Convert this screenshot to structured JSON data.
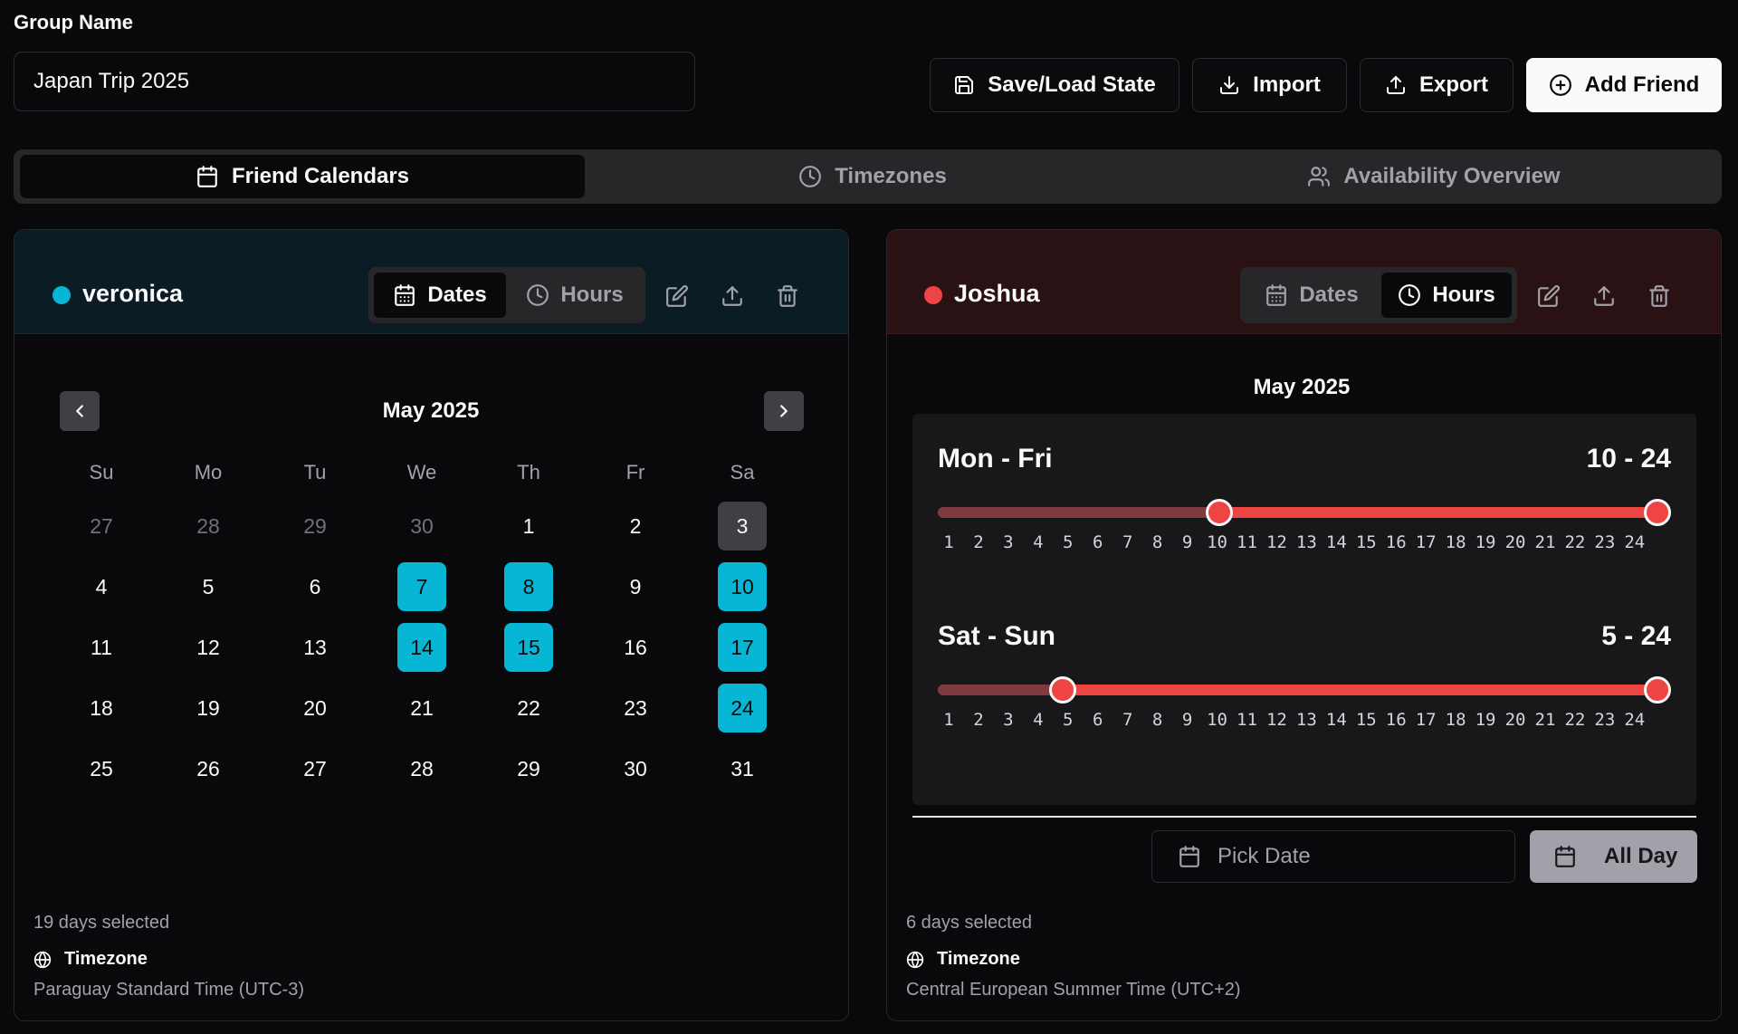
{
  "header": {
    "group_label": "Group Name",
    "group_value": "Japan Trip 2025",
    "buttons": {
      "save_load": "Save/Load State",
      "import": "Import",
      "export": "Export",
      "add_friend": "Add Friend"
    }
  },
  "tabs": {
    "friend_calendars": "Friend Calendars",
    "timezones": "Timezones",
    "availability_overview": "Availability Overview",
    "active": "friend_calendars"
  },
  "friends": [
    {
      "name": "veronica",
      "color": "#06b6d4",
      "mode_dates": "Dates",
      "mode_hours": "Hours",
      "active_mode": "Dates",
      "calendar": {
        "month_label": "May 2025",
        "weekdays": [
          "Su",
          "Mo",
          "Tu",
          "We",
          "Th",
          "Fr",
          "Sa"
        ],
        "weeks": [
          [
            {
              "d": "27",
              "out": true
            },
            {
              "d": "28",
              "out": true
            },
            {
              "d": "29",
              "out": true
            },
            {
              "d": "30",
              "out": true
            },
            {
              "d": "1"
            },
            {
              "d": "2"
            },
            {
              "d": "3",
              "today": true
            }
          ],
          [
            {
              "d": "4"
            },
            {
              "d": "5"
            },
            {
              "d": "6"
            },
            {
              "d": "7",
              "sel": true
            },
            {
              "d": "8",
              "sel": true
            },
            {
              "d": "9"
            },
            {
              "d": "10",
              "sel": true
            }
          ],
          [
            {
              "d": "11"
            },
            {
              "d": "12"
            },
            {
              "d": "13"
            },
            {
              "d": "14",
              "sel": true
            },
            {
              "d": "15",
              "sel": true
            },
            {
              "d": "16"
            },
            {
              "d": "17",
              "sel": true
            }
          ],
          [
            {
              "d": "18"
            },
            {
              "d": "19"
            },
            {
              "d": "20"
            },
            {
              "d": "21"
            },
            {
              "d": "22"
            },
            {
              "d": "23"
            },
            {
              "d": "24",
              "sel": true
            }
          ],
          [
            {
              "d": "25"
            },
            {
              "d": "26"
            },
            {
              "d": "27"
            },
            {
              "d": "28"
            },
            {
              "d": "29"
            },
            {
              "d": "30"
            },
            {
              "d": "31"
            }
          ]
        ]
      },
      "selected_count": "19 days selected",
      "timezone_label": "Timezone",
      "timezone": "Paraguay Standard Time (UTC-3)"
    },
    {
      "name": "Joshua",
      "color": "#ef4444",
      "mode_dates": "Dates",
      "mode_hours": "Hours",
      "active_mode": "Hours",
      "hours": {
        "month_label": "May 2025",
        "ranges": [
          {
            "label": "Mon - Fri",
            "value": "10 - 24",
            "start": 10,
            "end": 24
          },
          {
            "label": "Sat - Sun",
            "value": "5 - 24",
            "start": 5,
            "end": 24
          }
        ],
        "scale_min": 1,
        "scale_max": 24,
        "ticks": [
          "1",
          "2",
          "3",
          "4",
          "5",
          "6",
          "7",
          "8",
          "9",
          "10",
          "11",
          "12",
          "13",
          "14",
          "15",
          "16",
          "17",
          "18",
          "19",
          "20",
          "21",
          "22",
          "23",
          "24"
        ],
        "pick_date": "Pick Date",
        "all_day": "All Day"
      },
      "selected_count": "6 days selected",
      "timezone_label": "Timezone",
      "timezone": "Central European Summer Time (UTC+2)"
    }
  ]
}
